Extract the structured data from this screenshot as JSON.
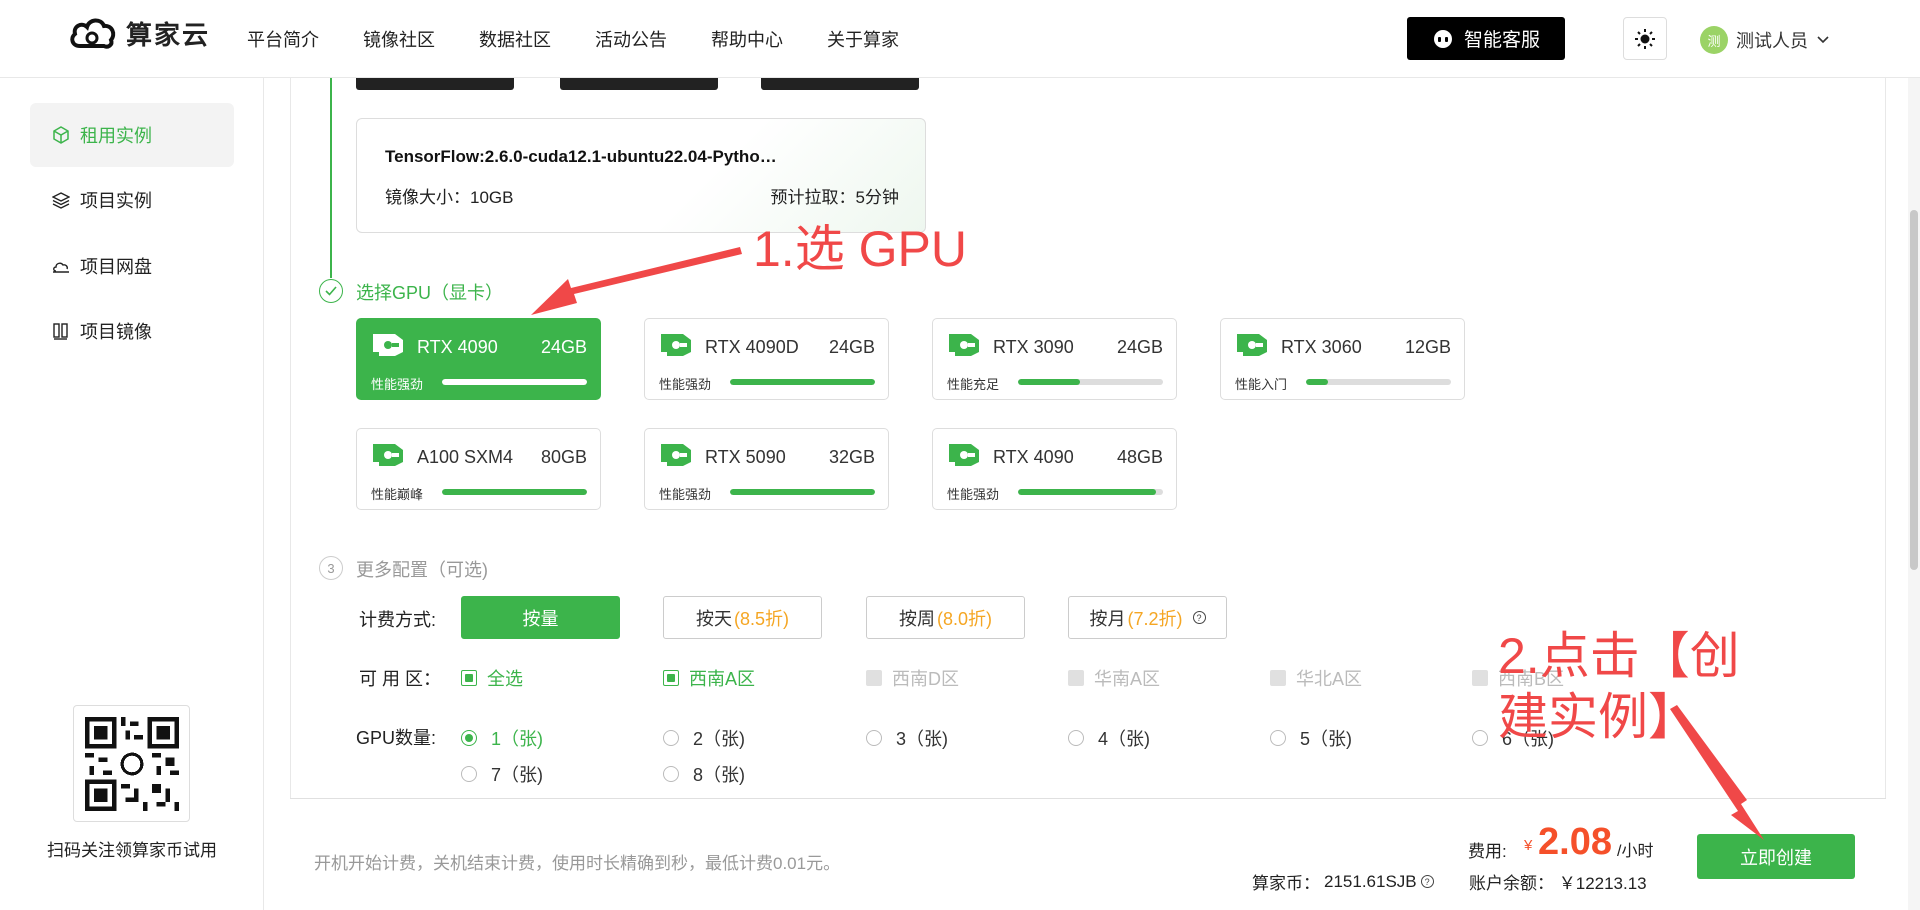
{
  "brand": {
    "name": "算家云"
  },
  "nav": [
    "平台简介",
    "镜像社区",
    "数据社区",
    "活动公告",
    "帮助中心",
    "关于算家"
  ],
  "header": {
    "service_label": "智能客服",
    "user_avatar_char": "测",
    "user_name": "测试人员"
  },
  "sidebar": {
    "items": [
      {
        "label": "租用实例",
        "icon": "cube-icon",
        "active": true
      },
      {
        "label": "项目实例",
        "icon": "layers-icon",
        "active": false
      },
      {
        "label": "项目网盘",
        "icon": "cloud-drive-icon",
        "active": false
      },
      {
        "label": "项目镜像",
        "icon": "image-stack-icon",
        "active": false
      }
    ],
    "qr_caption": "扫码关注领算家币试用"
  },
  "image_card": {
    "name": "TensorFlow:2.6.0-cuda12.1-ubuntu22.04-Pytho…",
    "size": "镜像大小：10GB",
    "pull": "预计拉取：5分钟"
  },
  "steps": {
    "gpu": {
      "label": "选择GPU（显卡）"
    },
    "config": {
      "number": "3",
      "label": "更多配置（可选)"
    }
  },
  "gpus": [
    {
      "name": "RTX 4090",
      "mem": "24GB",
      "level": "性能强劲",
      "perf": 1.0,
      "selected": true
    },
    {
      "name": "RTX 4090D",
      "mem": "24GB",
      "level": "性能强劲",
      "perf": 1.0,
      "selected": false
    },
    {
      "name": "RTX 3090",
      "mem": "24GB",
      "level": "性能充足",
      "perf": 0.43,
      "selected": false
    },
    {
      "name": "RTX 3060",
      "mem": "12GB",
      "level": "性能入门",
      "perf": 0.15,
      "selected": false
    },
    {
      "name": "A100 SXM4",
      "mem": "80GB",
      "level": "性能巅峰",
      "perf": 1.0,
      "selected": false
    },
    {
      "name": "RTX 5090",
      "mem": "32GB",
      "level": "性能强劲",
      "perf": 1.0,
      "selected": false
    },
    {
      "name": "RTX 4090",
      "mem": "48GB",
      "level": "性能强劲",
      "perf": 0.95,
      "selected": false
    }
  ],
  "billing": {
    "label": "计费方式:",
    "options": [
      {
        "text": "按量",
        "discount": "",
        "selected": true
      },
      {
        "text": "按天",
        "discount": "(8.5折)",
        "selected": false
      },
      {
        "text": "按周",
        "discount": "(8.0折)",
        "selected": false
      },
      {
        "text": "按月",
        "discount": "(7.2折)",
        "selected": false
      }
    ]
  },
  "zones": {
    "label": "可 用 区：",
    "options": [
      {
        "text": "全选",
        "state": "on"
      },
      {
        "text": "西南A区",
        "state": "on"
      },
      {
        "text": "西南D区",
        "state": "disabled"
      },
      {
        "text": "华南A区",
        "state": "disabled"
      },
      {
        "text": "华北A区",
        "state": "disabled"
      },
      {
        "text": "西南B区",
        "state": "disabled"
      }
    ]
  },
  "gpu_count": {
    "label": "GPU数量:",
    "options": [
      {
        "text": "1（张)",
        "selected": true
      },
      {
        "text": "2（张)",
        "selected": false
      },
      {
        "text": "3（张)",
        "selected": false
      },
      {
        "text": "4（张)",
        "selected": false
      },
      {
        "text": "5（张)",
        "selected": false
      },
      {
        "text": "6（张)",
        "selected": false
      },
      {
        "text": "7（张)",
        "selected": false
      },
      {
        "text": "8（张)",
        "selected": false
      }
    ]
  },
  "footer": {
    "note": "开机开始计费，关机结束计费，使用时长精确到秒，最低计费0.01元。",
    "fee_label": "费用:",
    "currency": "¥",
    "fee_value": "2.08",
    "fee_unit": "/小时",
    "coin_label": "算家币：",
    "coin_value": "2151.61SJB",
    "balance_label": "账户余额：",
    "balance_value": "￥12213.13",
    "create_label": "立即创建"
  },
  "annotations": {
    "step1": "1.选 GPU",
    "step2": "2.点击【创建实例】"
  },
  "colors": {
    "accent": "#3cb44b",
    "annotation": "#f04848",
    "price": "#f5502a",
    "discount": "#f5a623"
  }
}
